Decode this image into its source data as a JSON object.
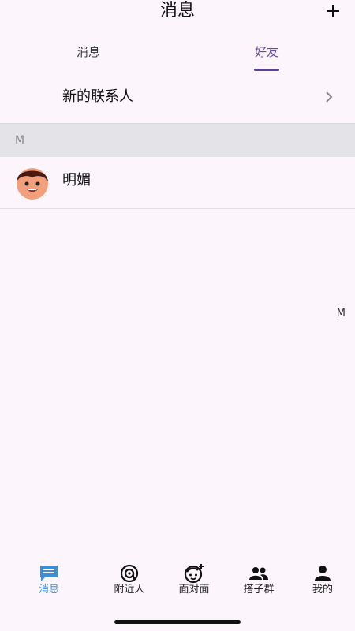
{
  "header": {
    "title": "消息"
  },
  "tabs": [
    {
      "label": "消息"
    },
    {
      "label": "好友"
    }
  ],
  "new_contacts": {
    "label": "新的联系人"
  },
  "section": {
    "letter": "M"
  },
  "contacts": [
    {
      "name": "明媚"
    }
  ],
  "index_bar": {
    "letters": [
      "M"
    ]
  },
  "bottom_nav": [
    {
      "label": "消息",
      "icon": "chat-bubble-icon",
      "active": true
    },
    {
      "label": "附近人",
      "icon": "at-radar-icon"
    },
    {
      "label": "面对面",
      "icon": "face-icon"
    },
    {
      "label": "搭子群",
      "icon": "group-icon"
    },
    {
      "label": "我的",
      "icon": "person-icon"
    }
  ],
  "colors": {
    "accent": "#5a3f9d",
    "nav_active": "#3b8fd6",
    "background": "#fcf6fc"
  }
}
